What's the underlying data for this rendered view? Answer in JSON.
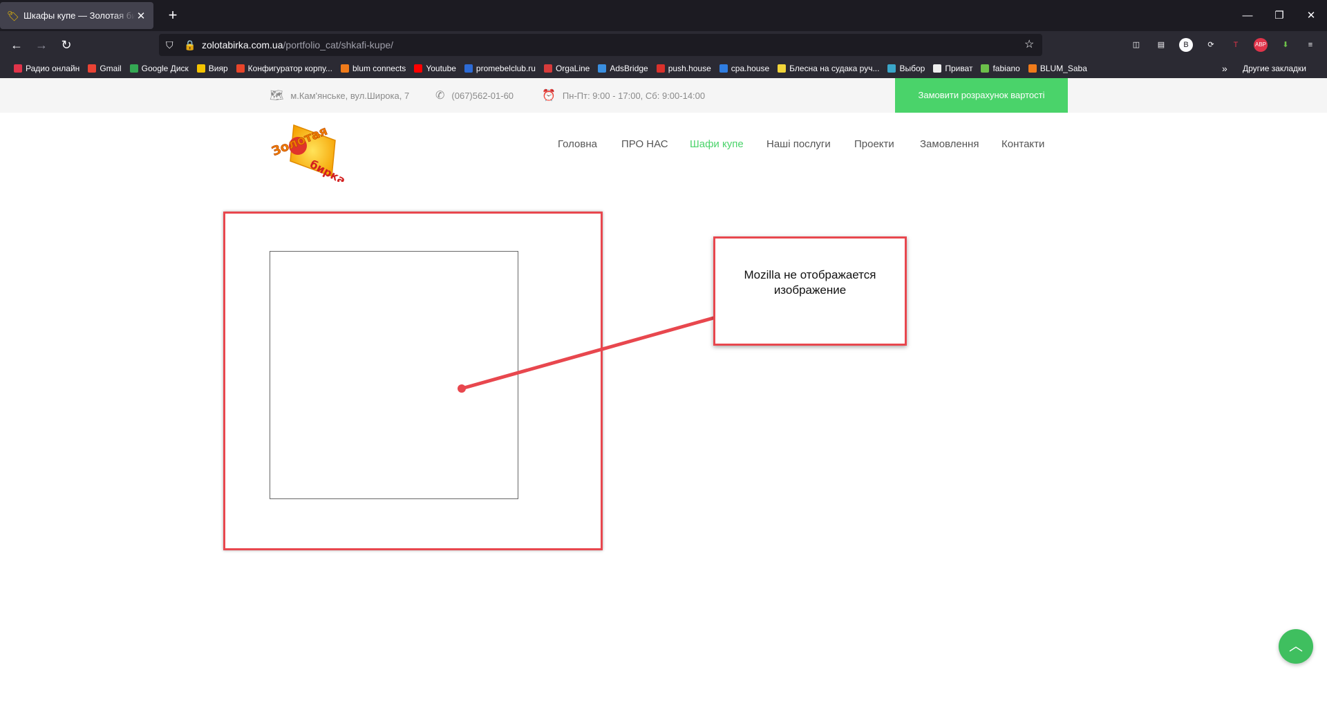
{
  "browser": {
    "tab_title": "Шкафы купе — Золотая бирка",
    "url_host": "zolotabirka.com.ua",
    "url_path": "/portfolio_cat/shkafi-kupe/",
    "bookmarks": [
      {
        "label": "Радио онлайн",
        "color": "#e0344a"
      },
      {
        "label": "Gmail",
        "color": "#ea4335"
      },
      {
        "label": "Google Диск",
        "color": "#34a853"
      },
      {
        "label": "Вияр",
        "color": "#f5c400"
      },
      {
        "label": "Конфигуратор корпу...",
        "color": "#e8452a"
      },
      {
        "label": "blum connects",
        "color": "#f07b1a"
      },
      {
        "label": "Youtube",
        "color": "#ff0000"
      },
      {
        "label": "promebelclub.ru",
        "color": "#2d6bd6"
      },
      {
        "label": "OrgaLine",
        "color": "#d63b3b"
      },
      {
        "label": "AdsBridge",
        "color": "#3a8fe0"
      },
      {
        "label": "push.house",
        "color": "#d9312b"
      },
      {
        "label": "cpa.house",
        "color": "#2f7de1"
      },
      {
        "label": "Блесна на судака руч...",
        "color": "#f2d53a"
      },
      {
        "label": "Выбор",
        "color": "#3aa6c9"
      },
      {
        "label": "Приват",
        "color": "#eeeeee"
      },
      {
        "label": "fabiano",
        "color": "#6cc04a"
      },
      {
        "label": "BLUM_Saba",
        "color": "#f07b1a"
      }
    ],
    "other_bookmarks": "Другие закладки"
  },
  "site": {
    "address": "м.Кам'янське, вул.Широка, 7",
    "phone": "(067)562-01-60",
    "hours": "Пн-Пт: 9:00 - 17:00, Сб: 9:00-14:00",
    "order_button": "Замовити розрахунок вартості",
    "nav": [
      "Головна",
      "ПРО НАС",
      "Шафи купе",
      "Наші послуги",
      "Проекти",
      "Замовлення",
      "Контакти"
    ],
    "active_nav": "Шафи купе",
    "logo_text_top": "Золотая",
    "logo_text_bottom": "бирка"
  },
  "annotation": {
    "callout_text": "Mozilla не отображается изображение",
    "color": "#e8474e"
  },
  "colors": {
    "accent_green": "#4ad36a",
    "browser_dark": "#1c1b22"
  }
}
